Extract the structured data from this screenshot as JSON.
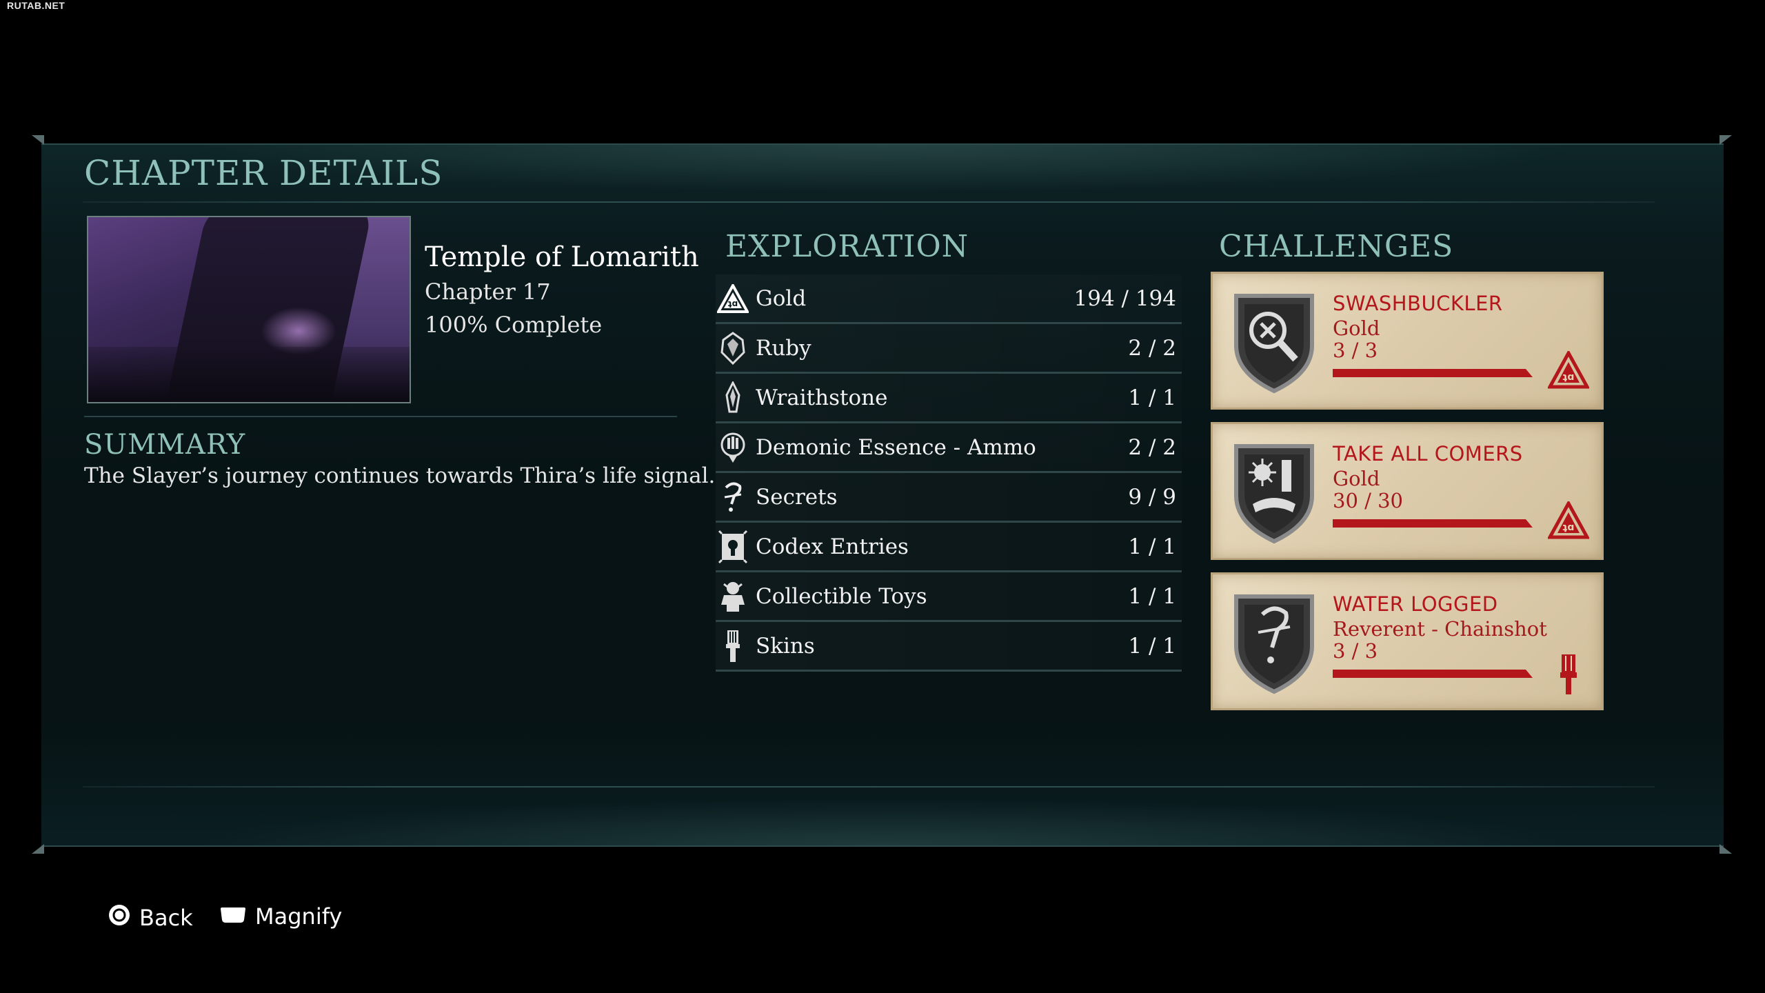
{
  "watermark": "RUTAB.NET",
  "panel": {
    "title": "CHAPTER DETAILS",
    "level": {
      "name": "Temple of Lomarith",
      "chapter": "Chapter 17",
      "completion": "100% Complete"
    },
    "summary": {
      "heading": "SUMMARY",
      "text": "The Slayer’s journey continues towards Thira’s life signal."
    }
  },
  "exploration": {
    "heading": "EXPLORATION",
    "items": [
      {
        "icon": "gold-icon",
        "label": "Gold",
        "count": "194 / 194"
      },
      {
        "icon": "ruby-icon",
        "label": "Ruby",
        "count": "2 / 2"
      },
      {
        "icon": "wraithstone-icon",
        "label": "Wraithstone",
        "count": "1 / 1"
      },
      {
        "icon": "demonic-essence-icon",
        "label": "Demonic Essence - Ammo",
        "count": "2 / 2"
      },
      {
        "icon": "secrets-icon",
        "label": "Secrets",
        "count": "9 / 9"
      },
      {
        "icon": "codex-icon",
        "label": "Codex Entries",
        "count": "1 / 1"
      },
      {
        "icon": "toy-icon",
        "label": "Collectible Toys",
        "count": "1 / 1"
      },
      {
        "icon": "skins-icon",
        "label": "Skins",
        "count": "1 / 1"
      }
    ]
  },
  "challenges": {
    "heading": "CHALLENGES",
    "cards": [
      {
        "title": "SWASHBUCKLER",
        "reward": "Gold",
        "progress": "3 / 3",
        "progress_fraction": 1.0,
        "reward_icon": "gold-icon"
      },
      {
        "title": "TAKE ALL COMERS",
        "reward": "Gold",
        "progress": "30 / 30",
        "progress_fraction": 1.0,
        "reward_icon": "gold-icon"
      },
      {
        "title": "WATER LOGGED",
        "reward": "Reverent - Chainshot",
        "progress": "3 / 3",
        "progress_fraction": 1.0,
        "reward_icon": "paintbrush-icon"
      }
    ]
  },
  "prompts": {
    "back": "Back",
    "magnify": "Magnify"
  },
  "colors": {
    "heading": "#8fc1b9",
    "challenge_text": "#b3161b",
    "card_bg": "#dccbab"
  }
}
